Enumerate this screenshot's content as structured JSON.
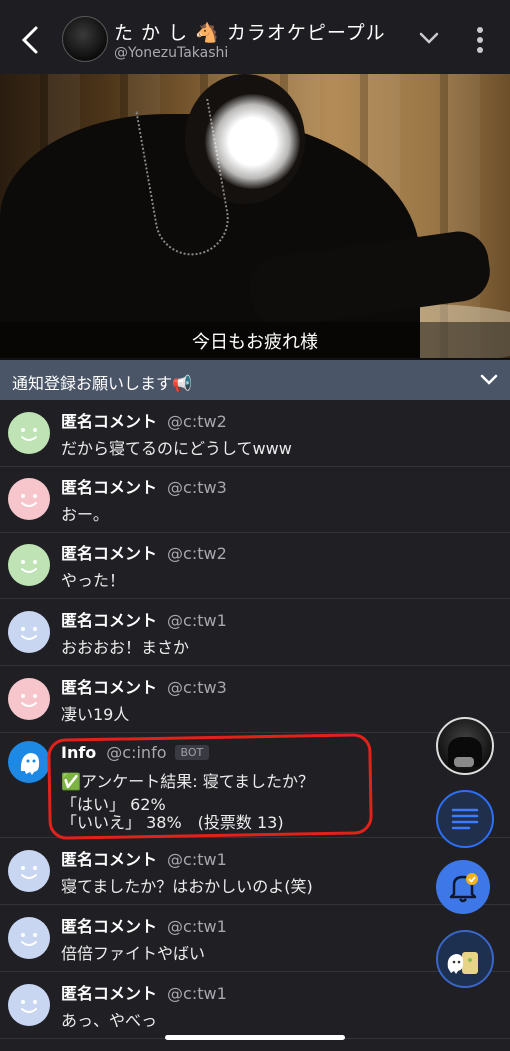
{
  "header": {
    "title": "た か し 🐴 カラオケピープル",
    "handle": "@YonezuTakashi"
  },
  "video": {
    "subtitle": "今日もお疲れ様"
  },
  "notice": {
    "text": "通知登録お願いします📢"
  },
  "comments": [
    {
      "name": "匿名コメント",
      "handle": "@c:tw2",
      "text": "だから寝てるのにどうしてwww",
      "color": "#bfe3b4"
    },
    {
      "name": "匿名コメント",
      "handle": "@c:tw3",
      "text": "おー。",
      "color": "#f6c6cc"
    },
    {
      "name": "匿名コメント",
      "handle": "@c:tw2",
      "text": "やった！",
      "color": "#bfe3b4"
    },
    {
      "name": "匿名コメント",
      "handle": "@c:tw1",
      "text": "おおおお！まさか",
      "color": "#c9d6f2"
    },
    {
      "name": "匿名コメント",
      "handle": "@c:tw3",
      "text": "凄い19人",
      "color": "#f6c6cc"
    }
  ],
  "info": {
    "name": "Info",
    "handle": "@c:info",
    "badge": "BOT",
    "line1": "✅アンケート結果: 寝てましたか？",
    "line2": "「はい」 62%",
    "line3": "「いいえ」 38%　(投票数 13)"
  },
  "comments2": [
    {
      "name": "匿名コメント",
      "handle": "@c:tw1",
      "text": "寝てましたか？はおかしいのよ(笑)",
      "color": "#c9d6f2"
    },
    {
      "name": "匿名コメント",
      "handle": "@c:tw1",
      "text": "倍倍ファイトやばい",
      "color": "#c9d6f2"
    },
    {
      "name": "匿名コメント",
      "handle": "@c:tw1",
      "text": "あっ、やべっ",
      "color": "#c9d6f2"
    }
  ],
  "colors": {
    "accent": "#2d6ff5",
    "highlight": "#e2221a"
  }
}
